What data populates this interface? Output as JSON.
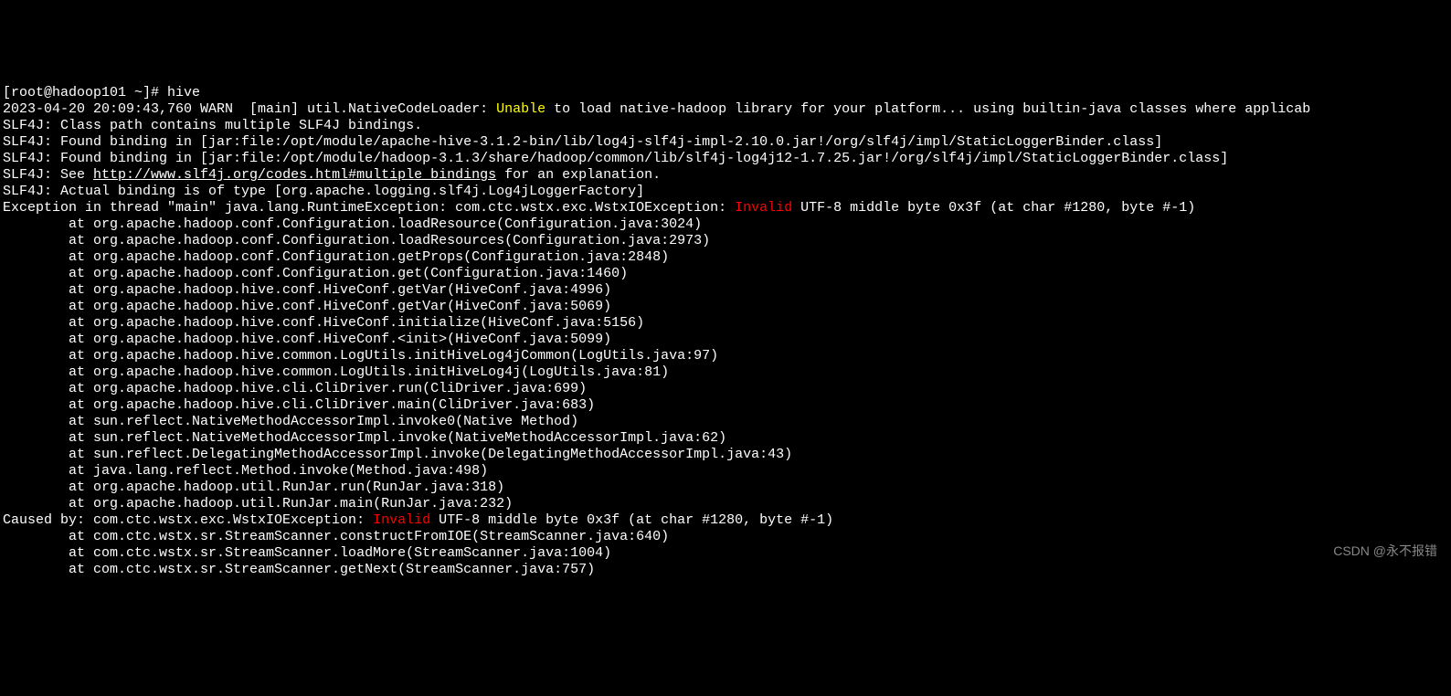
{
  "terminal": {
    "prompt": "[root@hadoop101 ~]# ",
    "command": "hive",
    "lines": [
      {
        "pre": "2023-04-20 20:09:43,760 WARN  [main] util.NativeCodeLoader: ",
        "yellow1": "Unable",
        "mid": " to load native-hadoop library for your platform... using builtin-java classes where applicab"
      },
      {
        "text": "SLF4J: Class path contains multiple SLF4J bindings."
      },
      {
        "text": "SLF4J: Found binding in [jar:file:/opt/module/apache-hive-3.1.2-bin/lib/log4j-slf4j-impl-2.10.0.jar!/org/slf4j/impl/StaticLoggerBinder.class]"
      },
      {
        "text": "SLF4J: Found binding in [jar:file:/opt/module/hadoop-3.1.3/share/hadoop/common/lib/slf4j-log4j12-1.7.25.jar!/org/slf4j/impl/StaticLoggerBinder.class]"
      },
      {
        "pre": "SLF4J: See ",
        "link": "http://www.slf4j.org/codes.html#multiple_bindings",
        "post": " for an explanation."
      },
      {
        "text": "SLF4J: Actual binding is of type [org.apache.logging.slf4j.Log4jLoggerFactory]"
      },
      {
        "pre": "Exception in thread \"main\" java.lang.RuntimeException: com.ctc.wstx.exc.WstxIOException: ",
        "red": "Invalid",
        "post": " UTF-8 middle byte 0x3f (at char #1280, byte #-1)"
      },
      {
        "text": "        at org.apache.hadoop.conf.Configuration.loadResource(Configuration.java:3024)"
      },
      {
        "text": "        at org.apache.hadoop.conf.Configuration.loadResources(Configuration.java:2973)"
      },
      {
        "text": "        at org.apache.hadoop.conf.Configuration.getProps(Configuration.java:2848)"
      },
      {
        "text": "        at org.apache.hadoop.conf.Configuration.get(Configuration.java:1460)"
      },
      {
        "text": "        at org.apache.hadoop.hive.conf.HiveConf.getVar(HiveConf.java:4996)"
      },
      {
        "text": "        at org.apache.hadoop.hive.conf.HiveConf.getVar(HiveConf.java:5069)"
      },
      {
        "text": "        at org.apache.hadoop.hive.conf.HiveConf.initialize(HiveConf.java:5156)"
      },
      {
        "text": "        at org.apache.hadoop.hive.conf.HiveConf.<init>(HiveConf.java:5099)"
      },
      {
        "text": "        at org.apache.hadoop.hive.common.LogUtils.initHiveLog4jCommon(LogUtils.java:97)"
      },
      {
        "text": "        at org.apache.hadoop.hive.common.LogUtils.initHiveLog4j(LogUtils.java:81)"
      },
      {
        "text": "        at org.apache.hadoop.hive.cli.CliDriver.run(CliDriver.java:699)"
      },
      {
        "text": "        at org.apache.hadoop.hive.cli.CliDriver.main(CliDriver.java:683)"
      },
      {
        "text": "        at sun.reflect.NativeMethodAccessorImpl.invoke0(Native Method)"
      },
      {
        "text": "        at sun.reflect.NativeMethodAccessorImpl.invoke(NativeMethodAccessorImpl.java:62)"
      },
      {
        "text": "        at sun.reflect.DelegatingMethodAccessorImpl.invoke(DelegatingMethodAccessorImpl.java:43)"
      },
      {
        "text": "        at java.lang.reflect.Method.invoke(Method.java:498)"
      },
      {
        "text": "        at org.apache.hadoop.util.RunJar.run(RunJar.java:318)"
      },
      {
        "text": "        at org.apache.hadoop.util.RunJar.main(RunJar.java:232)"
      },
      {
        "pre": "Caused by: com.ctc.wstx.exc.WstxIOException: ",
        "red": "Invalid",
        "post": " UTF-8 middle byte 0x3f (at char #1280, byte #-1)"
      },
      {
        "text": "        at com.ctc.wstx.sr.StreamScanner.constructFromIOE(StreamScanner.java:640)"
      },
      {
        "text": "        at com.ctc.wstx.sr.StreamScanner.loadMore(StreamScanner.java:1004)"
      },
      {
        "text": "        at com.ctc.wstx.sr.StreamScanner.getNext(StreamScanner.java:757)"
      }
    ]
  },
  "watermark": "CSDN @永不报错"
}
